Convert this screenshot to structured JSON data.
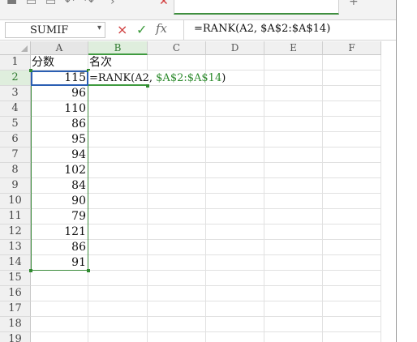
{
  "name_box": {
    "value": "SUMIF"
  },
  "formula_bar": {
    "cancel_icon": "×",
    "enter_icon": "✓",
    "fx_label": "fx",
    "formula": "=RANK(A2, $A$2:$A$14)"
  },
  "editing_cell": {
    "formula_prefix": "=RANK(A2, ",
    "formula_ref": "$A$2:$A$14",
    "formula_suffix": ")"
  },
  "columns": [
    "A",
    "B",
    "C",
    "D",
    "E",
    "F"
  ],
  "active_column": "B",
  "rows": [
    "1",
    "2",
    "3",
    "4",
    "5",
    "6",
    "7",
    "8",
    "9",
    "10",
    "11",
    "12",
    "13",
    "14",
    "15",
    "16",
    "17",
    "18",
    "19"
  ],
  "active_row": "2",
  "cells": {
    "A1": "分数",
    "B1": "名次",
    "A2": "115",
    "A3": "96",
    "A4": "110",
    "A5": "86",
    "A6": "95",
    "A7": "94",
    "A8": "102",
    "A9": "84",
    "A10": "90",
    "A11": "79",
    "A12": "121",
    "A13": "86",
    "A14": "91"
  },
  "colors": {
    "selection_green": "#3d8d3d",
    "active_blue": "#2b5fb3",
    "cancel_red": "#d04040",
    "enter_green": "#3a9a3a"
  }
}
